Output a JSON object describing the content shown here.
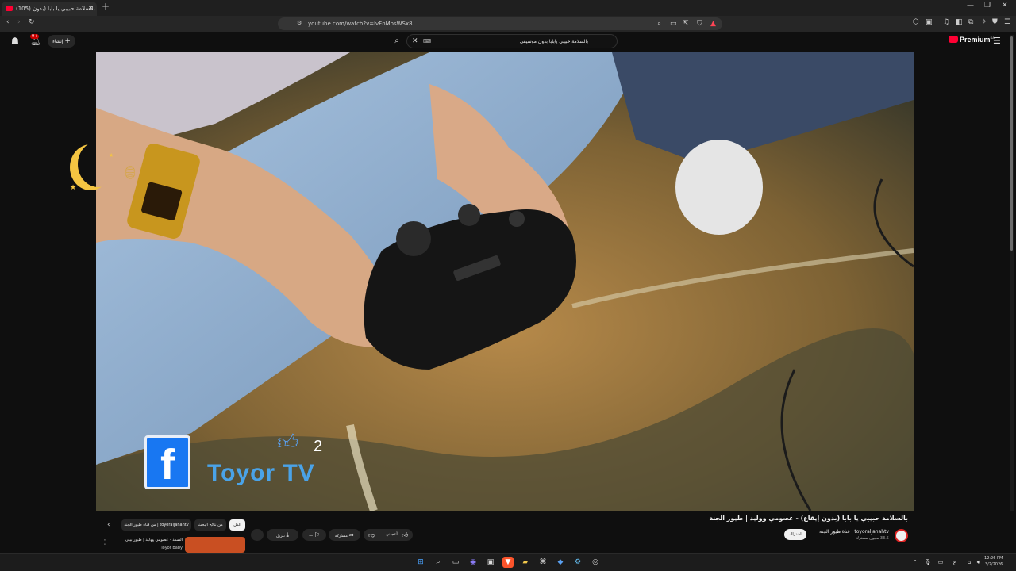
{
  "browser": {
    "tab_title": "(105) بالسلامة حبيبي يا بابا (بدون",
    "tab_close": "✕",
    "new_tab": "+",
    "url": "youtube.com/watch?v=lvFnMosWSx8",
    "window_controls": [
      "—",
      "❐",
      "✕"
    ]
  },
  "masthead": {
    "create_label": "إنشاء",
    "search_query": "بالسلامة حبيبي يابابا بدون موسيقى",
    "logo_text": "Premium",
    "logo_badge": "SA",
    "notification_count": "9+"
  },
  "video": {
    "overlay_likes": "2",
    "overlay_brand": "Toyor TV"
  },
  "info": {
    "title": "بالسلامة حبيبي يا بابا (بدون إيقاع) - عصومي ووليد | طيور الجنة",
    "channel_name": "toyoraljanahtv | قناة طيور الجنة",
    "subscribers": "33.5 مليون مشترك",
    "subscribe_label": "اشتراك",
    "like_label": "أعجبني",
    "share_label": "مشاركة",
    "download_label": "تنزيل",
    "save_placeholder": "—",
    "more_label": "⋯"
  },
  "chips": [
    {
      "label": "الكل",
      "active": true
    },
    {
      "label": "من نتائج البحث",
      "active": false
    },
    {
      "label": "من قناة طيور الجنة | toyoraljanahtv",
      "active": false
    }
  ],
  "recommendation": {
    "title": "الصمد - عصومي ووليد | طيور بيبي",
    "channel": "Toyor Baby"
  },
  "taskbar": {
    "time": "12:26 PM",
    "date": "3/2/2026",
    "lang": "ع"
  },
  "colors": {
    "brand_red": "#ff0033",
    "bg": "#0f0f0f",
    "chip_active": "#f1f1f1"
  }
}
